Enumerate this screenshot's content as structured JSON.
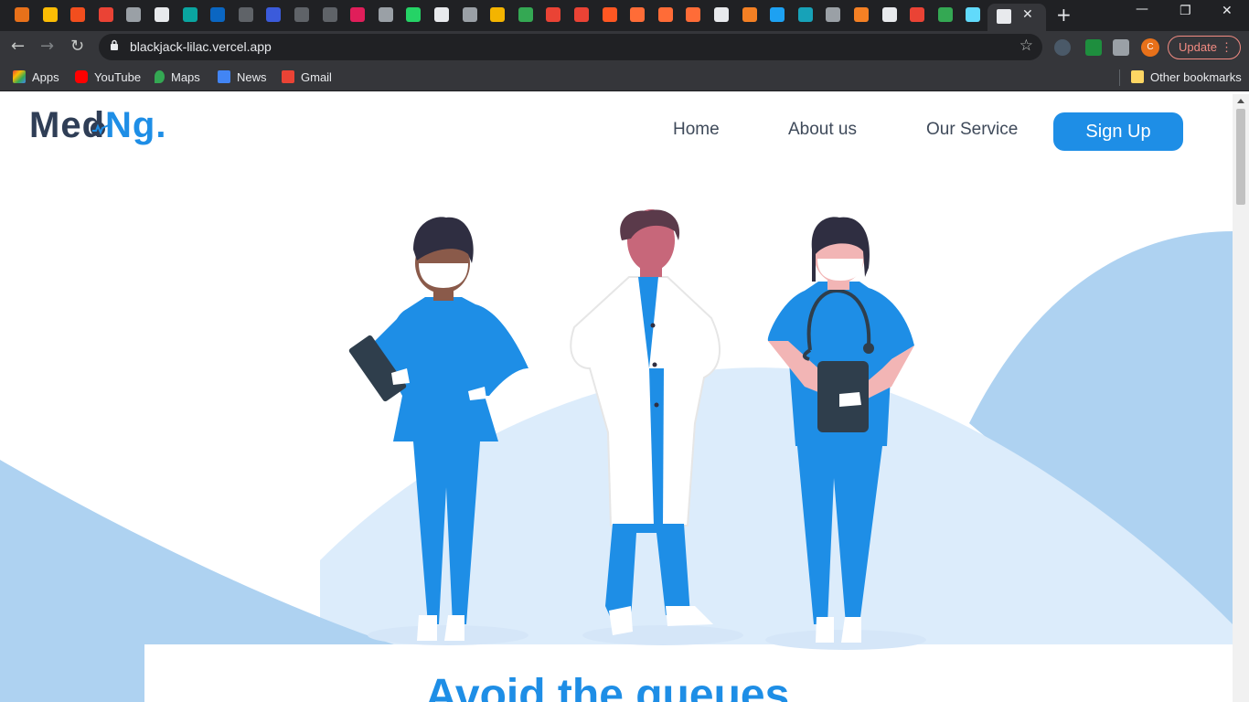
{
  "browser": {
    "url": "blackjack-lilac.vercel.app",
    "update_label": "Update",
    "profile_initial": "C",
    "bookmarks": [
      {
        "label": "Apps",
        "icon": "apps-grid-icon",
        "color": "#e94235"
      },
      {
        "label": "YouTube",
        "icon": "youtube-icon",
        "color": "#ff0000"
      },
      {
        "label": "Maps",
        "icon": "maps-icon",
        "color": "#34a853"
      },
      {
        "label": "News",
        "icon": "news-icon",
        "color": "#4285f4"
      },
      {
        "label": "Gmail",
        "icon": "gmail-icon",
        "color": "#ea4335"
      }
    ],
    "other_bookmarks": "Other bookmarks"
  },
  "site": {
    "logo_part1": "Med",
    "logo_part2": "Ng.",
    "nav": {
      "home": "Home",
      "about": "About us",
      "service": "Our Service",
      "signup": "Sign Up"
    },
    "heading": "Avoid the queues"
  },
  "colors": {
    "brand_blue": "#1e8ee6",
    "brand_dark": "#2f3e56",
    "hill_light": "#aed2f1",
    "hill_pale": "#dcecfb"
  }
}
